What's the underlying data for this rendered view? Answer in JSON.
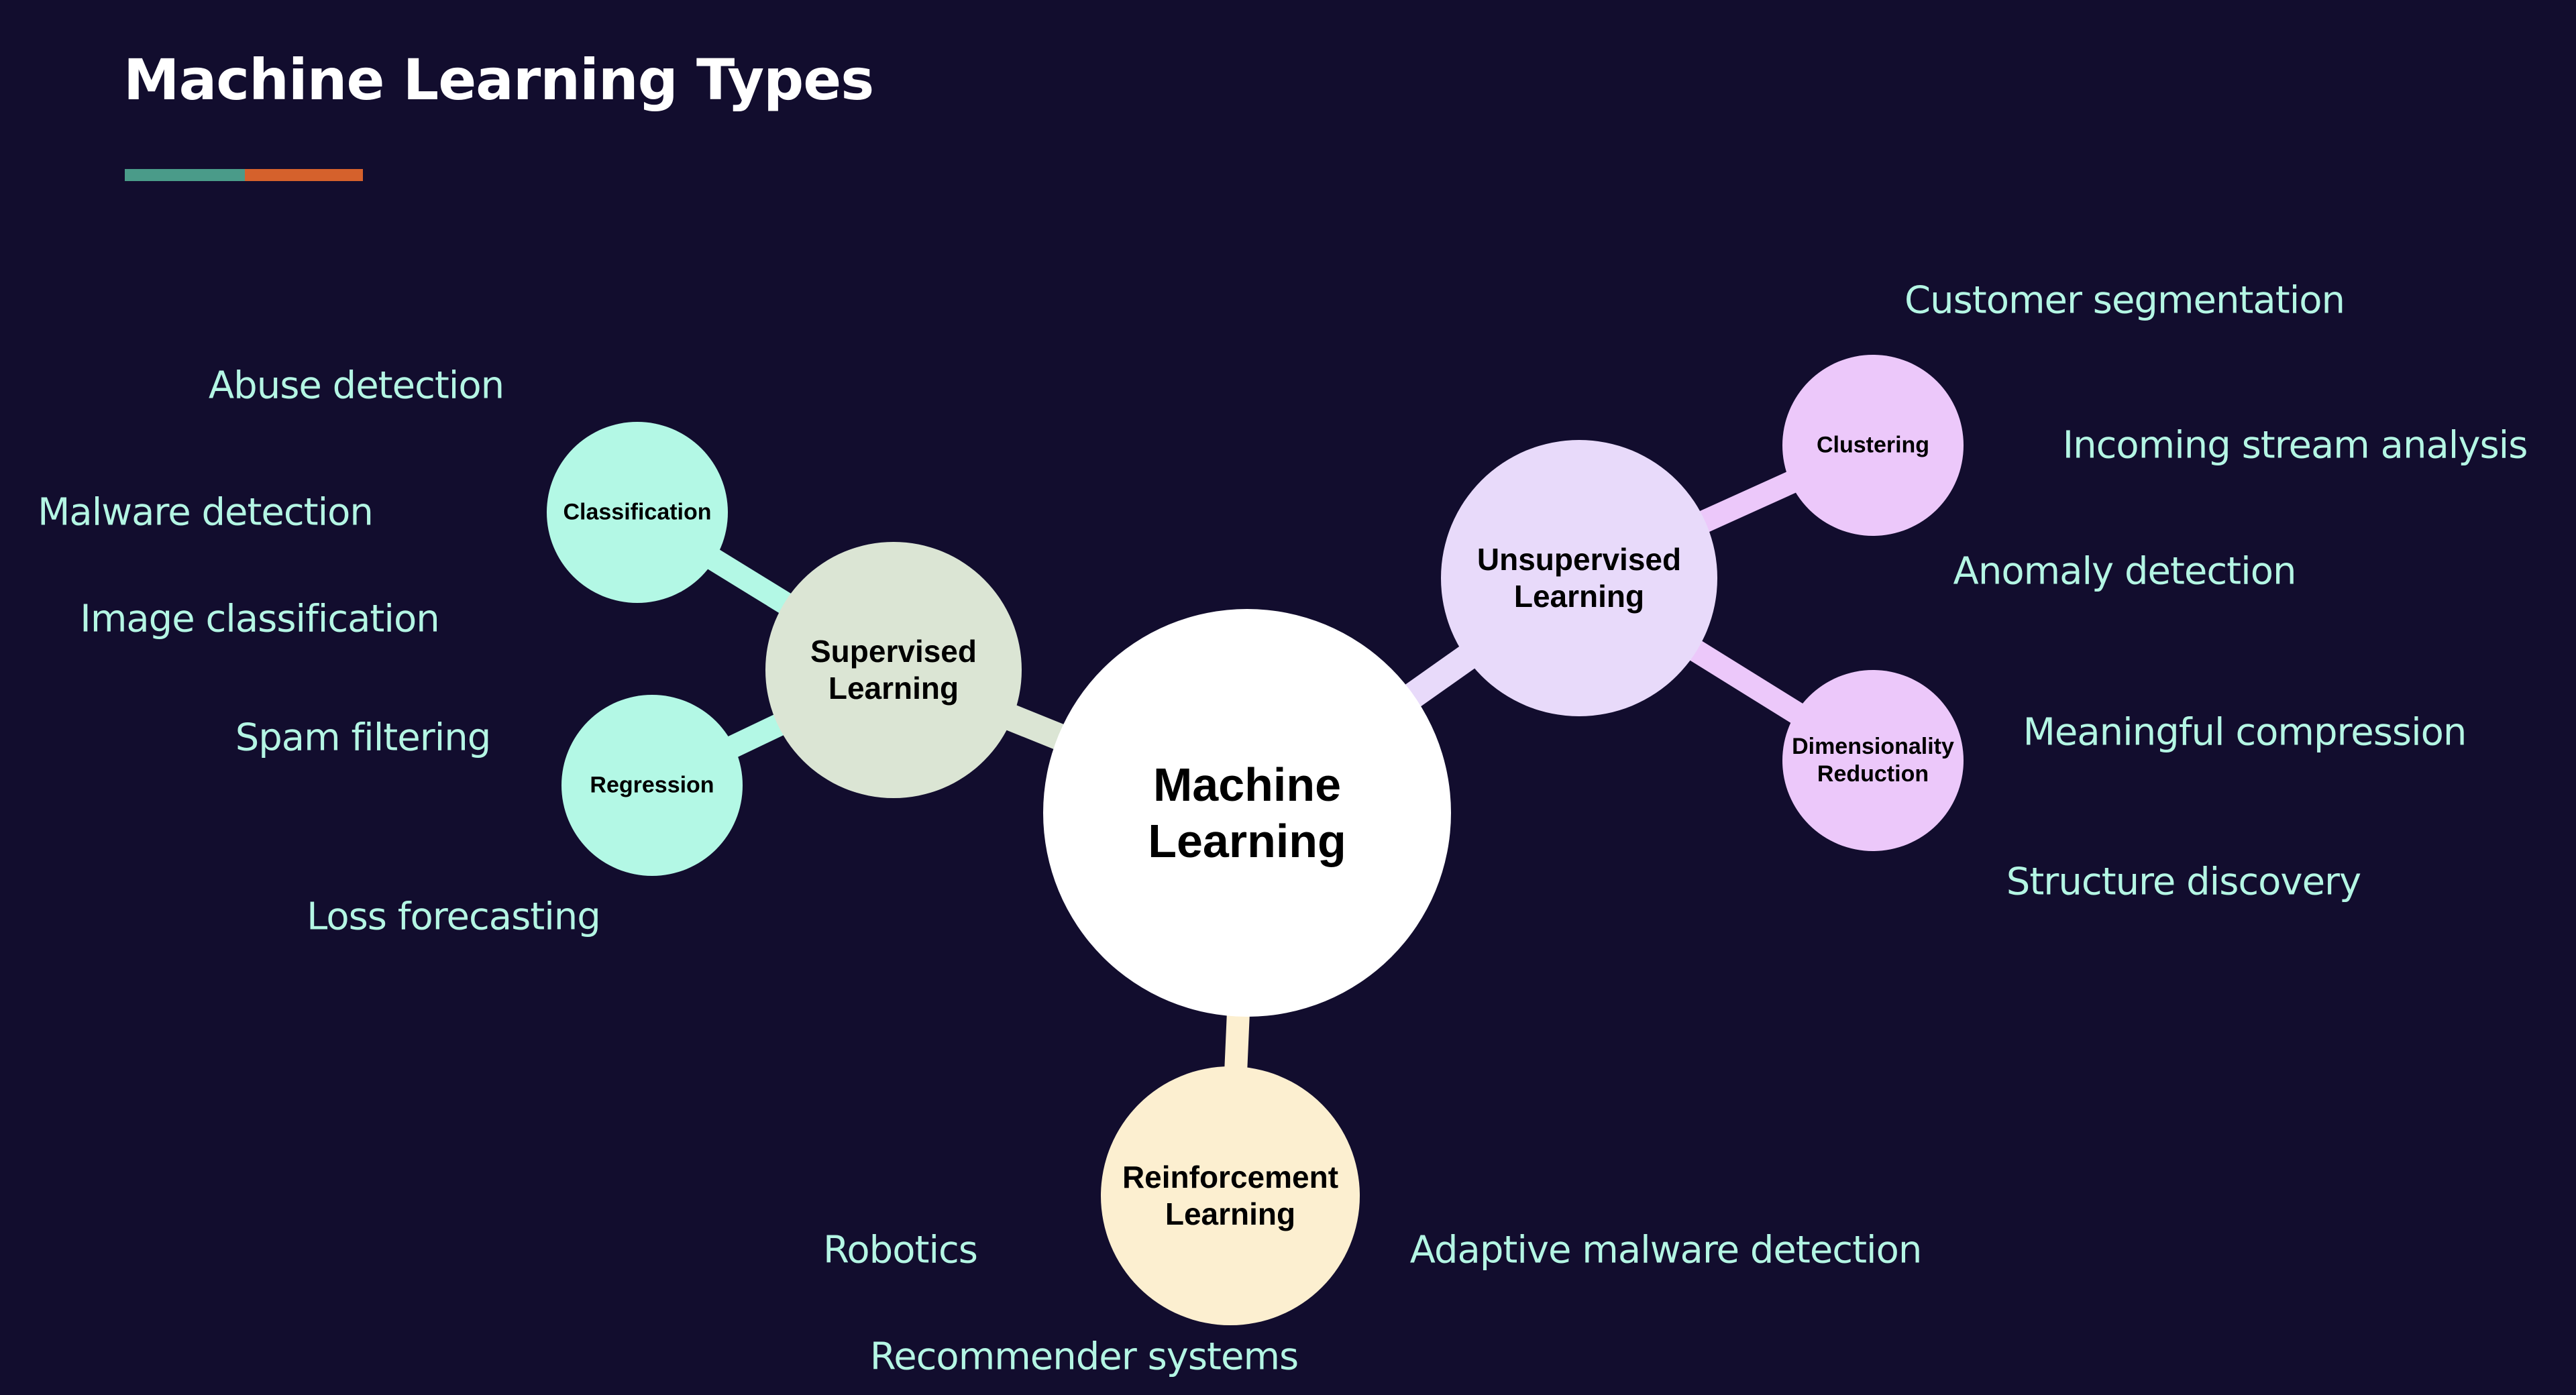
{
  "title": "Machine Learning Types",
  "colors": {
    "background": "#120d2e",
    "accent_teal": "#4a9b89",
    "accent_orange": "#d5612c",
    "leaf_text": "#b4f6e4",
    "center": "#ffffff",
    "supervised": "#dbe5d4",
    "supervised_children": "#b3f8e5",
    "unsupervised": "#e8dafa",
    "unsupervised_children": "#ecc8fa",
    "reinforcement": "#fcefd0"
  },
  "center": {
    "label": "Machine\nLearning"
  },
  "branches": [
    {
      "id": "supervised",
      "label": "Supervised\nLearning",
      "children": [
        {
          "id": "classification",
          "label": "Classification"
        },
        {
          "id": "regression",
          "label": "Regression"
        }
      ]
    },
    {
      "id": "unsupervised",
      "label": "Unsupervised\nLearning",
      "children": [
        {
          "id": "clustering",
          "label": "Clustering"
        },
        {
          "id": "dimensionality",
          "label": "Dimensionality\nReduction"
        }
      ]
    },
    {
      "id": "reinforcement",
      "label": "Reinforcement\nLearning",
      "children": []
    }
  ],
  "applications": [
    {
      "text": "Abuse detection",
      "group": "supervised"
    },
    {
      "text": "Malware detection",
      "group": "supervised"
    },
    {
      "text": "Image classification",
      "group": "supervised"
    },
    {
      "text": "Spam filtering",
      "group": "supervised"
    },
    {
      "text": "Loss forecasting",
      "group": "supervised"
    },
    {
      "text": "Customer segmentation",
      "group": "unsupervised"
    },
    {
      "text": "Incoming stream analysis",
      "group": "unsupervised"
    },
    {
      "text": "Anomaly detection",
      "group": "unsupervised"
    },
    {
      "text": "Meaningful compression",
      "group": "unsupervised"
    },
    {
      "text": "Structure discovery",
      "group": "unsupervised"
    },
    {
      "text": "Robotics",
      "group": "reinforcement"
    },
    {
      "text": "Adaptive malware detection",
      "group": "reinforcement"
    },
    {
      "text": "Recommender systems",
      "group": "reinforcement"
    }
  ]
}
